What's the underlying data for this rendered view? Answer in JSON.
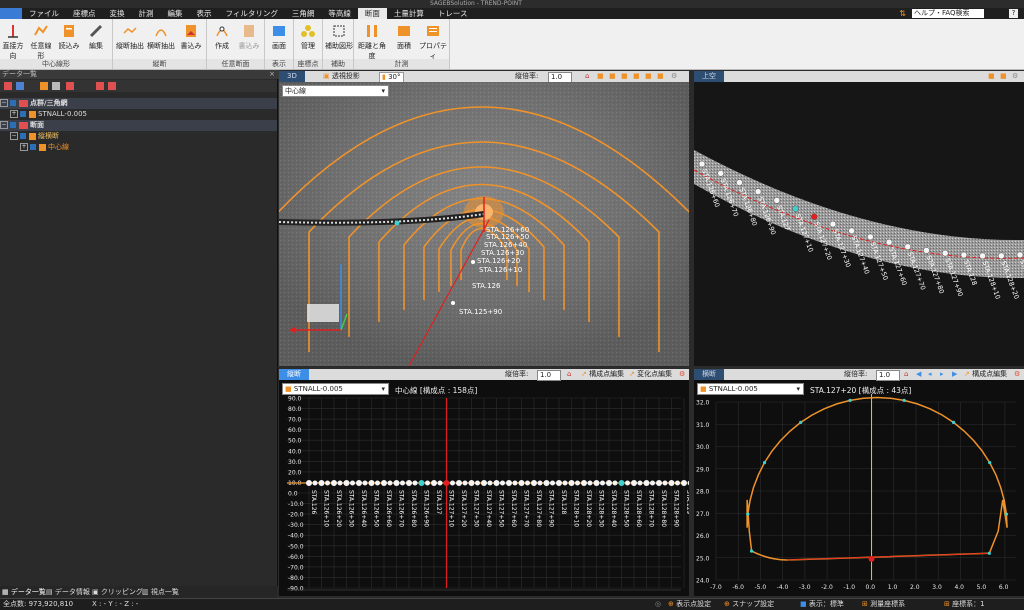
{
  "window": {
    "title": "SAGEBSolution - TREND-POINT"
  },
  "menu": [
    "ファイル",
    "座標点",
    "変換",
    "計測",
    "編集",
    "表示",
    "フィルタリング",
    "三角網",
    "等高線",
    "断面",
    "土量計算",
    "トレース"
  ],
  "menu_active": "断面",
  "help": {
    "label": "ヘルプ・FAQ検索"
  },
  "ribbon": {
    "groups": [
      {
        "label": "中心線形",
        "buttons": [
          "直接方向",
          "任意線形",
          "読込み",
          "編集"
        ]
      },
      {
        "label": "縦断",
        "buttons": [
          "縦断抽出",
          "横断抽出",
          "書込み"
        ]
      },
      {
        "label": "任意断面",
        "buttons": [
          "作成",
          "書込み"
        ]
      },
      {
        "label": "表示",
        "buttons": [
          "画面"
        ]
      },
      {
        "label": "座標点",
        "buttons": [
          "管理"
        ]
      },
      {
        "label": "補助",
        "buttons": [
          "補助図形"
        ]
      },
      {
        "label": "計測",
        "buttons": [
          "距離と角度",
          "面積",
          "プロパティ"
        ]
      }
    ]
  },
  "left_panel": {
    "title": "データ一覧",
    "tree": [
      {
        "label": "点群/三角網",
        "level": 0
      },
      {
        "label": "STNALL-0.005",
        "level": 1
      },
      {
        "label": "断面",
        "level": 0
      },
      {
        "label": "縦横断",
        "level": 1
      },
      {
        "label": "中心線",
        "level": 2
      }
    ],
    "bottom_tabs": [
      "データ一覧",
      "データ情報",
      "クリッピング",
      "視点一覧"
    ]
  },
  "view3d": {
    "tab": "3D",
    "projection": "透視投影",
    "fov": "30°",
    "scale_label": "縦倍率:",
    "scale_value": "1.0",
    "dropdown": "中心線",
    "stations": [
      "STA.126+60",
      "STA.126+50",
      "STA.126+40",
      "STA.126+30",
      "STA.126+20",
      "STA.126+10",
      "STA.126",
      "STA.125+90"
    ]
  },
  "plan": {
    "tab": "上空",
    "stations": [
      "STA.126+60",
      "STA.126+70",
      "STA.126+80",
      "STA.126+90",
      "STA.127",
      "STA.127+10",
      "STA.127+20",
      "STA.127+30",
      "STA.127+40",
      "STA.127+50",
      "STA.127+60",
      "STA.127+70",
      "STA.127+80",
      "STA.127+90",
      "STA.128",
      "STA.128+10",
      "STA.128+20",
      "STA.128+30"
    ]
  },
  "profile": {
    "tab": "縦断",
    "scale_label": "縦倍率:",
    "scale_value": "1.0",
    "btn1": "構成点編集",
    "btn2": "変化点編集",
    "dropdown": "STNALL-0.005",
    "title": "中心線 [構成点 : 158点]",
    "y_ticks": [
      "90.0",
      "80.0",
      "70.0",
      "60.0",
      "50.0",
      "40.0",
      "30.0",
      "20.0",
      "10.0",
      "0.0",
      "-10.0",
      "-20.0",
      "-30.0",
      "-40.0",
      "-50.0",
      "-60.0",
      "-70.0",
      "-80.0",
      "-90.0"
    ],
    "stations": [
      "STA.126",
      "STA.126+10",
      "STA.126+20",
      "STA.126+30",
      "STA.126+40",
      "STA.126+50",
      "STA.126+60",
      "STA.126+70",
      "STA.126+80",
      "STA.126+90",
      "STA.127",
      "STA.127+10",
      "STA.127+20",
      "STA.127+30",
      "STA.127+40",
      "STA.127+50",
      "STA.127+60",
      "STA.127+70",
      "STA.127+80",
      "STA.127+90",
      "STA.128",
      "STA.128+10",
      "STA.128+20",
      "STA.128+30",
      "STA.128+40",
      "STA.128+50",
      "STA.128+60",
      "STA.128+70",
      "STA.128+80",
      "STA.128+90",
      "STA.129"
    ]
  },
  "cross": {
    "tab": "横断",
    "scale_label": "縦倍率:",
    "scale_value": "1.0",
    "btn": "構成点編集",
    "dropdown": "STNALL-0.005",
    "title": "STA.127+20 [構成点 : 43点]",
    "y_ticks": [
      "32.0",
      "31.0",
      "30.0",
      "29.0",
      "28.0",
      "27.0",
      "26.0",
      "25.0",
      "24.0"
    ],
    "x_ticks": [
      "-7.0",
      "-6.0",
      "-5.0",
      "-4.0",
      "-3.0",
      "-2.0",
      "-1.0",
      "0.0",
      "1.0",
      "2.0",
      "3.0",
      "4.0",
      "5.0",
      "6.0"
    ]
  },
  "status": {
    "points": "全点数: 973,920,810",
    "coord": "X : - Y : - Z : -",
    "items": [
      "表示点設定",
      "スナップ設定",
      "表示：標準",
      "測量座標系",
      "座標系：1"
    ]
  },
  "colors": {
    "accent": "#3d8ee6",
    "orange": "#f0922a",
    "red": "#e02020",
    "cyan": "#3fd0d0"
  }
}
